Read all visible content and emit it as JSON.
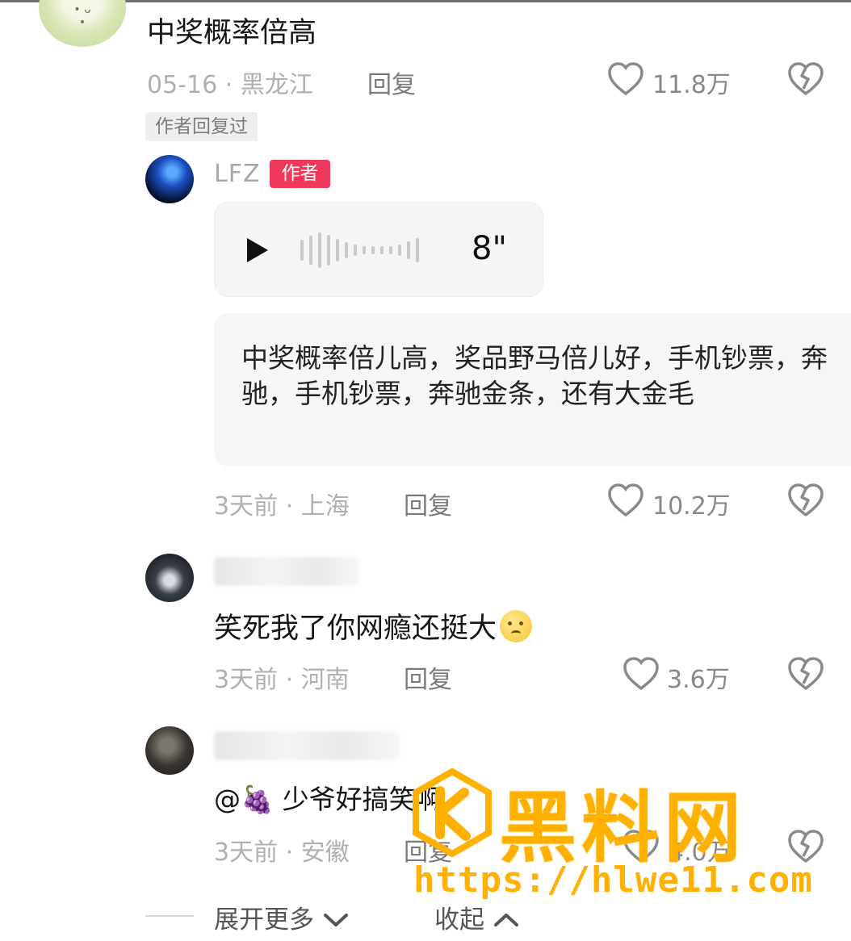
{
  "comments": [
    {
      "text": "中奖概率倍高",
      "meta": "05-16 · 黑龙江",
      "reply": "回复",
      "likes": "11.8万",
      "tag": "作者回复过"
    }
  ],
  "author_reply": {
    "name": "LFZ",
    "badge": "作者",
    "voice_duration": "8\"",
    "transcript": "中奖概率倍儿高，奖品野马倍儿好，手机钞票，奔驰，手机钞票，奔驰金条，还有大金毛",
    "meta": "3天前 · 上海",
    "reply": "回复",
    "likes": "10.2万"
  },
  "reply2": {
    "text": "笑死我了你网瘾还挺大",
    "meta": "3天前 · 河南",
    "reply": "回复",
    "likes": "3.6万"
  },
  "reply3": {
    "text": "@🍇 少爷好搞笑啊，",
    "meta": "3天前 · 安徽",
    "reply": "回复",
    "likes": "4.0万"
  },
  "footer": {
    "expand": "展开更多",
    "collapse": "收起"
  },
  "watermark": {
    "title": "黑料网",
    "url": "https://hlwe11.com"
  },
  "colors": {
    "author_badge": "#f0395a",
    "watermark": "#ffb000"
  }
}
